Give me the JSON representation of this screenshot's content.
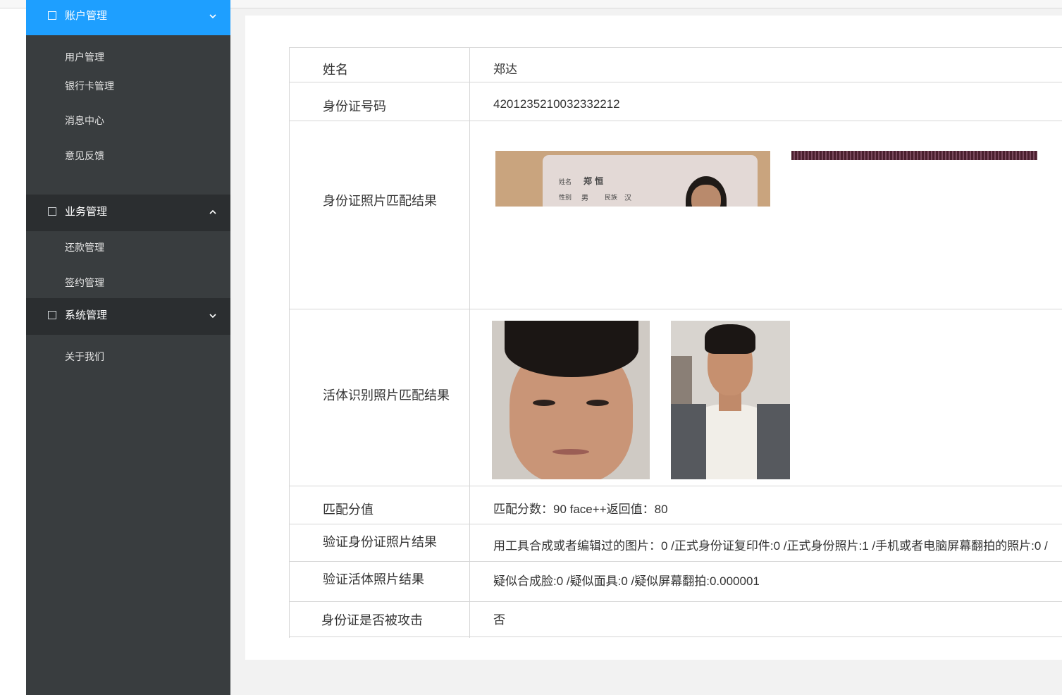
{
  "sidebar": {
    "groups": [
      {
        "label": "账户管理",
        "items": [
          "用户管理",
          "银行卡管理",
          "消息中心",
          "意见反馈"
        ]
      },
      {
        "label": "业务管理",
        "items": [
          "还款管理",
          "签约管理"
        ]
      },
      {
        "label": "系统管理",
        "items": [
          "关于我们"
        ]
      }
    ]
  },
  "detail": {
    "name_label": "姓名",
    "name_value": "郑达",
    "id_label": "身份证号码",
    "id_value": "4201235210032332212",
    "id_photo_label": "身份证照片匹配结果",
    "id_card_text": {
      "name_key": "姓名",
      "name_val": "郑 恒",
      "sex_key": "性别",
      "sex_val": "男",
      "nation_key": "民族",
      "nation_val": "汉"
    },
    "live_photo_label": "活体识别照片匹配结果",
    "score_label": "匹配分值",
    "score_value": "匹配分数：90  face++返回值：80",
    "verify_id_label": "验证身份证照片结果",
    "verify_id_value": "用工具合成或者编辑过的图片：0 /正式身份证复印件:0 /正式身份照片:1 /手机或者电脑屏幕翻拍的照片:0 /",
    "verify_live_label": "验证活体照片结果",
    "verify_live_value": "疑似合成脸:0 /疑似面具:0 /疑似屏幕翻拍:0.000001",
    "attack_label": "身份证是否被攻击",
    "attack_value": "否"
  },
  "icons": {
    "checkbox": "square-outline",
    "collapse": "chevron-up",
    "expand": "chevron-down"
  },
  "colors": {
    "sidebar_bg": "#393d3f",
    "active": "#1e9fff",
    "group_dark": "#2b2e30"
  }
}
